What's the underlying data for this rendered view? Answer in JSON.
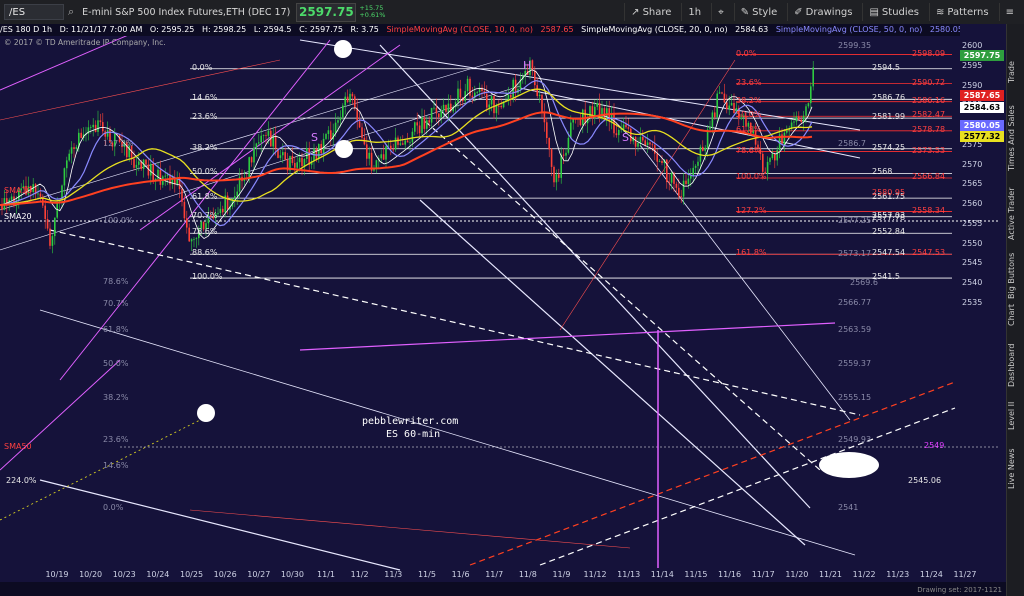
{
  "toolbar": {
    "symbol": "/ES",
    "description": "E-mini S&P 500 Index Futures,ETH (DEC 17)",
    "last_price": "2597.75",
    "change": "+15.75",
    "change_pct": "+0.61%",
    "share": "Share",
    "interval": "1h",
    "style": "Style",
    "drawings": "Drawings",
    "studies": "Studies",
    "patterns": "Patterns"
  },
  "status": {
    "chart_id": "/ES 180 D 1h",
    "date": "D: 11/21/17 7:00 AM",
    "open": "O: 2595.25",
    "high": "H: 2598.25",
    "low": "L: 2594.5",
    "close": "C: 2597.75",
    "range": "R: 3.75",
    "sma10": "SimpleMovingAvg (CLOSE, 10, 0, no)",
    "sma10_val": "2587.65",
    "sma20": "SimpleMovingAvg (CLOSE, 20, 0, no)",
    "sma20_val": "2584.63",
    "sma50": "SimpleMovingAvg (CLOSE, 50, 0, no)",
    "sma50_val": "2580.05"
  },
  "copyright": "© 2017 © TD Ameritrade IP Company, Inc.",
  "watermark": {
    "line1": "pebblewriter.com",
    "line2": "ES 60-min"
  },
  "sma_labels": {
    "sma10": "SMA10",
    "sma20": "SMA20",
    "sma50": "SMA50"
  },
  "hs_labels": {
    "left_s": "S",
    "head": "H",
    "right_s": "S"
  },
  "price_ticks": [
    "2600",
    "2595",
    "2590",
    "2585",
    "2580",
    "2575",
    "2570",
    "2565",
    "2560",
    "2555",
    "2550",
    "2545",
    "2540",
    "2535"
  ],
  "date_ticks": [
    "10/19",
    "10/20",
    "10/23",
    "10/24",
    "10/25",
    "10/26",
    "10/27",
    "10/30",
    "11/1",
    "11/2",
    "11/3",
    "11/5",
    "11/6",
    "11/7",
    "11/8",
    "11/9",
    "11/12",
    "11/13",
    "11/14",
    "11/15",
    "11/16",
    "11/17",
    "11/20",
    "11/21",
    "11/22",
    "11/23",
    "11/24",
    "11/27"
  ],
  "price_tags": [
    {
      "label": "2597.75",
      "bg": "#2e9e3e",
      "fg": "#ffffff"
    },
    {
      "label": "2587.65",
      "bg": "#e02020",
      "fg": "#ffffff"
    },
    {
      "label": "2584.63",
      "bg": "#ffffff",
      "fg": "#000000"
    },
    {
      "label": "2580.05",
      "bg": "#6a6aff",
      "fg": "#ffffff"
    },
    {
      "label": "2577.32",
      "bg": "#e8e020",
      "fg": "#000000"
    }
  ],
  "fib_left": [
    {
      "pct": "0.0%",
      "value": "2594.5"
    },
    {
      "pct": "14.6%",
      "value": "2586.76"
    },
    {
      "pct": "23.6%",
      "value": "2581.99"
    },
    {
      "pct": "38.2%",
      "value": "2574.25"
    },
    {
      "pct": "50.0%",
      "value": "2568"
    },
    {
      "pct": "61.8%",
      "value": "2561.75"
    },
    {
      "pct": "70.7%",
      "value": "2557.03"
    },
    {
      "pct": "78.6%",
      "value": "2552.84"
    },
    {
      "pct": "88.6%",
      "value": "2547.54"
    },
    {
      "pct": "100.0%",
      "value": "2541.5"
    }
  ],
  "fib_red": [
    {
      "pct": "0.0%",
      "value": "2598.09"
    },
    {
      "pct": "23.6%",
      "value": "2590.72"
    },
    {
      "pct": "38.2%",
      "value": "2586.16"
    },
    {
      "pct": "50.0%",
      "value": "2582.47"
    },
    {
      "pct": "61.8%",
      "value": "2578.78"
    },
    {
      "pct": "78.6%",
      "value": "2573.53"
    },
    {
      "pct": "100.0%",
      "value": "2566.84"
    },
    {
      "pct": "127.2%",
      "value": "2558.34"
    },
    {
      "pct": "161.8%",
      "value": "2547.53"
    }
  ],
  "extra_labels": {
    "v2580_95": "2580.95",
    "v2577_78": "2577.78",
    "v2545_06": "2545.06",
    "v2549": "2549",
    "v2546_72": "2546.72",
    "g2599_35": "2599.35",
    "g2586_7": "2586.7",
    "g2577_25": "2577.25",
    "g2573_17": "2573.17",
    "g2569_6": "2569.6",
    "g2566_77": "2566.77",
    "g2563_59": "2563.59",
    "g2559_37": "2559.37",
    "g2555_15": "2555.15",
    "g2549_93": "2549.93",
    "g2541": "2541",
    "lp127": "127.2%",
    "lp100": "100.0%",
    "lp786": "78.6%",
    "lp707": "70.7%",
    "lp618": "61.8%",
    "lp50": "50.0%",
    "lp382": "38.2%",
    "lp236": "23.6%",
    "lp146": "14.6%",
    "lp224": "224.0%",
    "lp0": "0.0%"
  },
  "sidebar": [
    "Trade",
    "Times And Sales",
    "Active Trader",
    "Big Buttons",
    "Chart",
    "Dashboard",
    "Level II",
    "Live News"
  ],
  "footer": "Drawing set: 2017-1121"
}
